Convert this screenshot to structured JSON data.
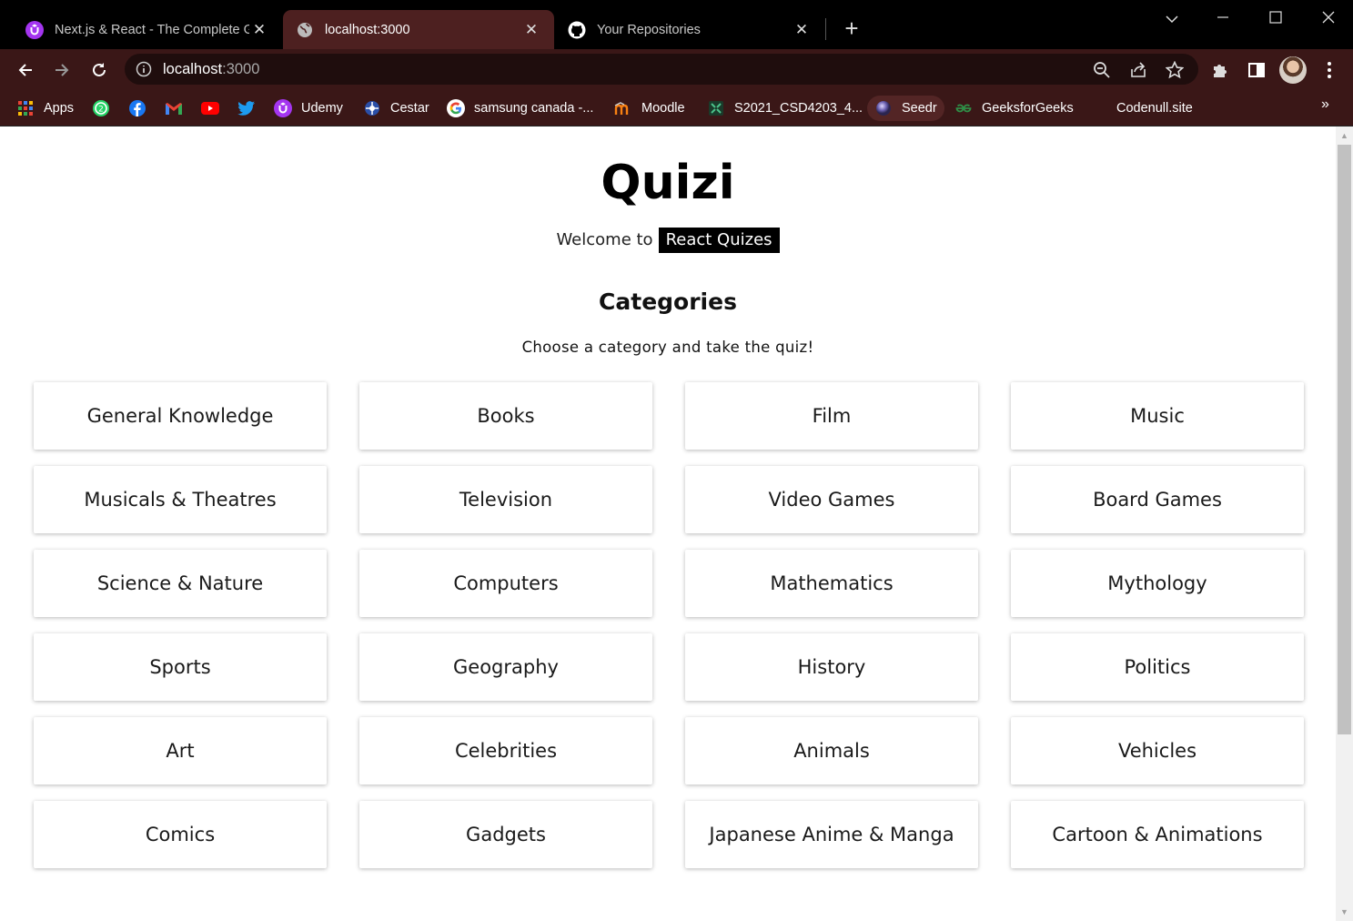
{
  "browser": {
    "tabs": [
      {
        "title": "Next.js & React - The Complete G",
        "active": false,
        "favicon": "udemy-icon"
      },
      {
        "title": "localhost:3000",
        "active": true,
        "favicon": "globe-icon"
      },
      {
        "title": "Your Repositories",
        "active": false,
        "favicon": "github-icon"
      }
    ],
    "url_host": "localhost",
    "url_port": ":3000",
    "bookmarks": [
      {
        "label": "Apps",
        "icon": "apps-grid-icon"
      },
      {
        "label": "",
        "icon": "whatsapp-icon"
      },
      {
        "label": "",
        "icon": "facebook-icon"
      },
      {
        "label": "",
        "icon": "gmail-icon"
      },
      {
        "label": "",
        "icon": "youtube-icon"
      },
      {
        "label": "",
        "icon": "twitter-icon"
      },
      {
        "label": "Udemy",
        "icon": "udemy-icon"
      },
      {
        "label": "Cestar",
        "icon": "cestar-icon"
      },
      {
        "label": "samsung canada -...",
        "icon": "google-icon"
      },
      {
        "label": "Moodle",
        "icon": "moodle-icon"
      },
      {
        "label": "S2021_CSD4203_4...",
        "icon": "teams-icon"
      },
      {
        "label": "Seedr",
        "icon": "seedr-icon"
      },
      {
        "label": "GeeksforGeeks",
        "icon": "gfg-icon"
      },
      {
        "label": "Codenull.site",
        "icon": ""
      }
    ],
    "bookmarks_overflow": "»"
  },
  "app": {
    "title": "Quizi",
    "welcome_prefix": "Welcome to",
    "welcome_highlight": "React Quizes",
    "categories_heading": "Categories",
    "categories_subtitle": "Choose a category and take the quiz!",
    "categories": [
      "General Knowledge",
      "Books",
      "Film",
      "Music",
      "Musicals & Theatres",
      "Television",
      "Video Games",
      "Board Games",
      "Science & Nature",
      "Computers",
      "Mathematics",
      "Mythology",
      "Sports",
      "Geography",
      "History",
      "Politics",
      "Art",
      "Celebrities",
      "Animals",
      "Vehicles",
      "Comics",
      "Gadgets",
      "Japanese Anime & Manga",
      "Cartoon & Animations"
    ]
  },
  "colors": {
    "tab_active_bg": "#4d2020",
    "toolbar_bg": "#3a1717",
    "page_bg": "#ffffff",
    "highlight_bg": "#000000"
  }
}
